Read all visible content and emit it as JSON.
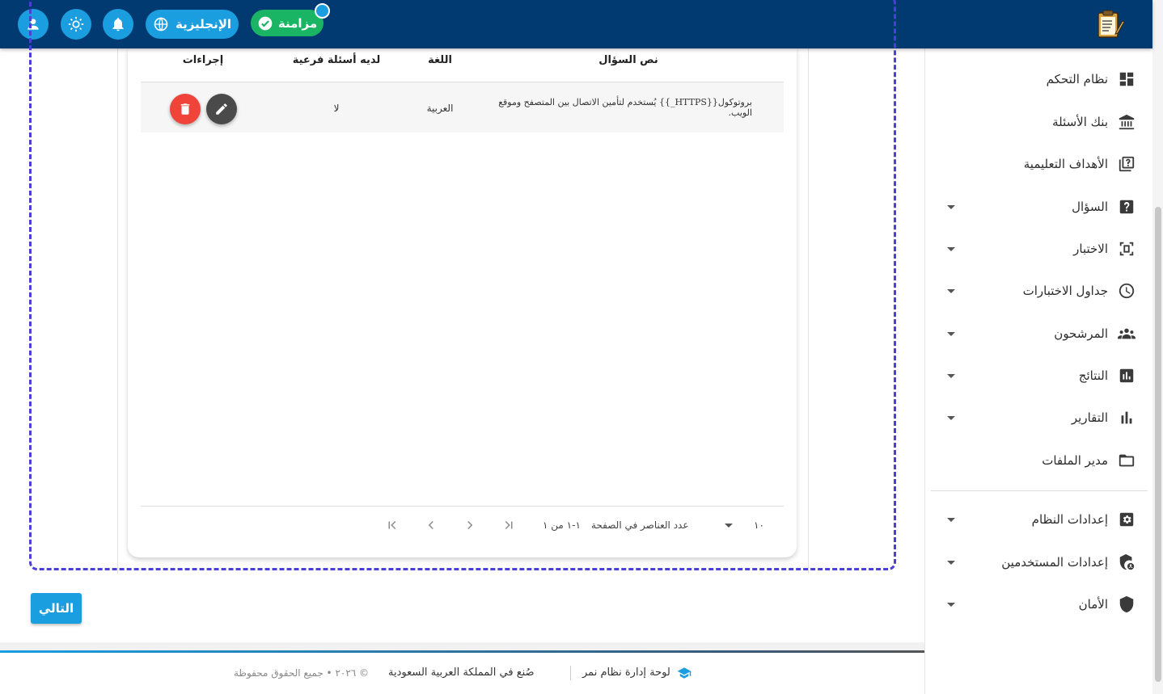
{
  "topbar": {
    "sync_label": "مزامنة",
    "language_label": "الإنجليزية",
    "icons": [
      "user-icon",
      "sun-icon",
      "bell-icon",
      "globe-icon",
      "check-circle-icon",
      "exam-logo-icon"
    ]
  },
  "sidebar": {
    "items": [
      {
        "label": "نظام التحكم",
        "icon": "dashboard-icon",
        "has_caret": false
      },
      {
        "label": "بنك الأسئلة",
        "icon": "bank-icon",
        "has_caret": false
      },
      {
        "label": "الأهداف التعليمية",
        "icon": "book-question-icon",
        "has_caret": false
      },
      {
        "label": "السؤال",
        "icon": "question-icon",
        "has_caret": true
      },
      {
        "label": "الاختبار",
        "icon": "exam-icon",
        "has_caret": true
      },
      {
        "label": "جداول الاختبارات",
        "icon": "clock-icon",
        "has_caret": true
      },
      {
        "label": "المرشحون",
        "icon": "people-icon",
        "has_caret": true
      },
      {
        "label": "النتائج",
        "icon": "poll-icon",
        "has_caret": true
      },
      {
        "label": "التقارير",
        "icon": "bar-chart-icon",
        "has_caret": true
      },
      {
        "label": "مدير الملفات",
        "icon": "folder-icon",
        "has_caret": false
      },
      {
        "label": "إعدادات النظام",
        "icon": "settings-icon",
        "has_caret": true
      },
      {
        "label": "إعدادات المستخدمين",
        "icon": "user-shield-icon",
        "has_caret": true
      },
      {
        "label": "الأمان",
        "icon": "shield-icon",
        "has_caret": true
      }
    ]
  },
  "table": {
    "headers": {
      "question_text": "نص السؤال",
      "language": "اللغة",
      "has_subquestions": "لديه أسئلة فرعية",
      "actions": "إجراءات"
    },
    "rows": [
      {
        "question_text": "بروتوكول{{HTTPS_}} يُستخدم لتأمين الاتصال بين المتصفح وموقع الويب.",
        "language": "العربية",
        "has_subquestions": "لا"
      }
    ]
  },
  "pagination": {
    "items_per_page_label": "عدد العناصر في الصفحة",
    "items_per_page_value": "١٠",
    "range_label": "١-١ من ١"
  },
  "actions": {
    "next_label": "التالي"
  },
  "footer": {
    "brand": "لوحة إدارة نظام نمر",
    "made_in": "صُنع في المملكة العربية السعودية",
    "copyright": "© ٢٠٢٦ • جميع الحقوق محفوظة"
  },
  "colors": {
    "topbar": "#003a70",
    "accent": "#1a9ee0",
    "sync": "#19b564",
    "delete": "#f0443a",
    "edit": "#4a4a4a",
    "focus_outline": "#4b3fd6"
  }
}
